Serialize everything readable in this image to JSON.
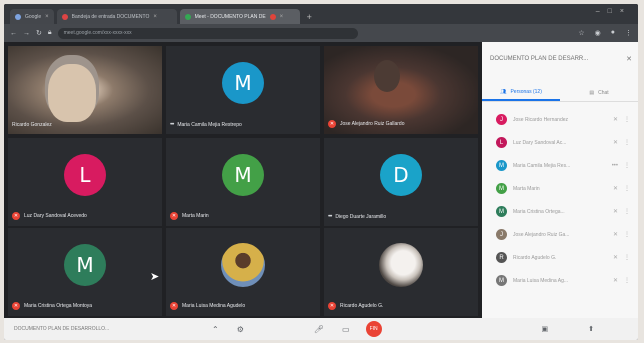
{
  "browser": {
    "tabs": [
      {
        "label": "Google"
      },
      {
        "label": "Bandeja de entrada DOCUMENTO"
      },
      {
        "label": "Meet - DOCUMENTO PLAN DE"
      }
    ],
    "url": "meet.google.com/xxx-xxxx-xxx"
  },
  "tiles": [
    {
      "name": "Ricardo Gonzalez",
      "kind": "photo-man"
    },
    {
      "name": "Maria Camila Mejia Restrepo",
      "kind": "avatar",
      "letter": "M",
      "color": "#1a97c9",
      "muted": false
    },
    {
      "name": "Jose Alejandro Ruiz Gallardo",
      "kind": "photo-dark",
      "muted": true
    },
    {
      "name": "Luz Dary Sandoval Acevedo",
      "kind": "avatar",
      "letter": "L",
      "color": "#d81b60",
      "muted": true
    },
    {
      "name": "Marta Marin",
      "kind": "avatar",
      "letter": "M",
      "color": "#43a047",
      "muted": true
    },
    {
      "name": "Diego Duarte Jaramillo",
      "kind": "avatar",
      "letter": "D",
      "color": "#1aa3c9",
      "muted": false
    },
    {
      "name": "Maria Cristina Ortega Montoya",
      "kind": "avatar",
      "letter": "M",
      "color": "#2e7d5b",
      "muted": true
    },
    {
      "name": "Maria Luisa Medina Agudelo",
      "kind": "mini-yellow",
      "muted": true
    },
    {
      "name": "Ricardo Agudelo G.",
      "kind": "mini-white",
      "muted": true
    }
  ],
  "panel": {
    "title": "DOCUMENTO PLAN DE DESARR...",
    "tab_people": "Personas (12)",
    "tab_chat": "Chat",
    "people": [
      {
        "name": "Jose Ricardo Hernandez",
        "letter": "J",
        "color": "#d81b60"
      },
      {
        "name": "Luz Dary Sandoval Ac...",
        "letter": "L",
        "color": "#c2185b"
      },
      {
        "name": "Maria Camila Mejia Res...",
        "letter": "M",
        "color": "#1a97c9"
      },
      {
        "name": "Marta Marin",
        "letter": "M",
        "color": "#43a047"
      },
      {
        "name": "Maria Cristina Ortega...",
        "letter": "M",
        "color": "#2e7d5b"
      },
      {
        "name": "Jose Alejandro Ruiz Ga...",
        "letter": "J",
        "color": "#8a7a6a"
      },
      {
        "name": "Ricardo Agudelo G.",
        "letter": "R",
        "color": "#555555"
      },
      {
        "name": "Maria Luisa Medina Ag...",
        "letter": "M",
        "color": "#777777"
      }
    ]
  },
  "bottom": {
    "meeting_title": "DOCUMENTO PLAN DE DESARROLLO...",
    "end_label": "FIN"
  }
}
